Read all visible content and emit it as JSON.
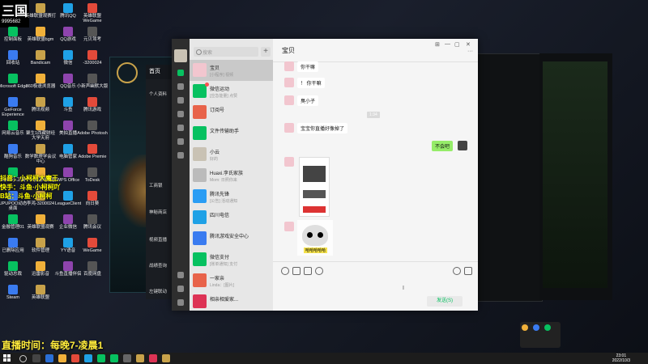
{
  "overlay": {
    "top_left_big": "三国",
    "top_left_num": "9995682",
    "line1": "抖音：小柯柯大魔王",
    "line2": "快手：斗鱼·小柯柯吖",
    "line3": "B站：斗鱼·小柯柯",
    "live_time": "直播时间：每晚7-凌晨1"
  },
  "desktop_icons": [
    "此电脑",
    "英雄联盟观赛打",
    "腾讯QQ",
    "英雄联盟WeGame",
    "控制面板",
    "英雄联盟bgm",
    "QQ游戏",
    "元贝驾考",
    "回收站",
    "Bandicam",
    "微信",
    "-3200024",
    "Microsoft Edge",
    "360极速浏览器",
    "QQ音乐",
    "小新声幽默大版",
    "GeForce Experience",
    "腾讯视频",
    "斗鱼",
    "腾讯游戏",
    "网易云音乐",
    "聚生1西藏财经大学天府",
    "美拍直播",
    "Adobe Photosh",
    "酷狗音乐",
    "数学数理学会议中心",
    "电脑管家",
    "Adobe Premie",
    "EDFL小工具",
    "个人资源电视剧",
    "WPS Office",
    "ToDesk",
    "UPUPOO动态桌面",
    "李鸿-3200024",
    "LeagueClient",
    "向日葵",
    "金融管理01",
    "英雄联盟观赛",
    "企业微信",
    "腾讯会议",
    "已删除应用",
    "软件管理",
    "YY语音",
    "WeGame",
    "驱动总裁",
    "迅雷影音",
    "斗鱼直播伴侣",
    "百度网盘",
    "Steam",
    "英雄联盟"
  ],
  "client": {
    "title": "首页",
    "items": [
      "个人资料",
      "工商银",
      "神秘商店",
      "视频直播",
      "战绩查询",
      "左键联动"
    ]
  },
  "wechat": {
    "search_placeholder": "搜索",
    "add_label": "+",
    "chats": [
      {
        "name": "宝贝",
        "preview": "[小程序] 视频",
        "time": "",
        "selected": true
      },
      {
        "name": "微信运动",
        "preview": "[应急能量] 点赞",
        "time": "",
        "badge": true
      },
      {
        "name": "订阅号",
        "preview": "",
        "time": ""
      },
      {
        "name": "文件传输助手",
        "preview": "",
        "time": ""
      },
      {
        "name": "小云",
        "preview": "好的",
        "time": ""
      },
      {
        "name": "Huaxi.李氏家族",
        "preview": "Mom:  日照你来",
        "time": ""
      },
      {
        "name": "腾讯先锋",
        "preview": "[公告] 活动通知",
        "time": ""
      },
      {
        "name": "四川电信",
        "preview": "",
        "time": ""
      },
      {
        "name": "腾讯游戏安全中心",
        "preview": "",
        "time": ""
      },
      {
        "name": "微信支付",
        "preview": "[账单通知] 支付",
        "time": ""
      },
      {
        "name": "一家亲",
        "preview": "Linda：[图片]",
        "time": ""
      },
      {
        "name": "相亲相爱家...",
        "preview": "",
        "time": ""
      }
    ],
    "chat_title": "宝贝",
    "window_buttons": [
      "⊞",
      "—",
      "▢",
      "✕"
    ],
    "more": "···",
    "messages": [
      {
        "from": "them",
        "text": "你干嘛"
      },
      {
        "from": "them",
        "text": "！ 你干嘛"
      },
      {
        "from": "them",
        "text": "臭小子"
      },
      {
        "from": "them",
        "text": "宝宝你直播好像掉了"
      },
      {
        "from": "me",
        "text": "不会吧"
      }
    ],
    "time_label": "1:34",
    "sticker_caption": "哈哈哈哈哈",
    "send_label": "发送(S)"
  },
  "taskbar": {
    "time": "23:01",
    "date": "2022/10/3"
  },
  "colors": {
    "wechat_green": "#07c160",
    "bubble_me": "#95ec69",
    "sidebar": "#2e2e2e",
    "list_bg": "#e7e7e7"
  }
}
